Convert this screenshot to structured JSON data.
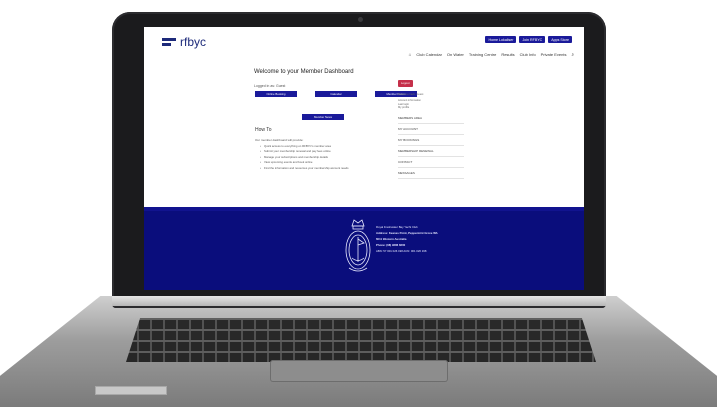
{
  "site": {
    "logo_text": "rfbyc",
    "top_buttons": [
      "Home Lokaliser",
      "Join RFBYC",
      "Apps Store"
    ],
    "nav": [
      "Club Calendar",
      "On Water",
      "Training Centre",
      "Results",
      "Club Info",
      "Private Events"
    ]
  },
  "main": {
    "welcome_title": "Welcome to your Member Dashboard",
    "logged_in": "Logged in as: Guest",
    "buttons": [
      "Online Booking",
      "Calendar",
      "Member Forum"
    ],
    "button_row2": "Member News",
    "how_title": "How To",
    "how_intro": "Our member dashboard will provide:",
    "how_items": [
      "Quick access to everything on RFBYC's member area",
      "Submit your membership renewal and pay fees online",
      "Manage your subscriptions and membership details",
      "View upcoming events and book online",
      "Find the information and resources your membership account needs"
    ]
  },
  "sidebar": {
    "logout_label": "Logout",
    "user_line": "Welcome back, Guest",
    "meta_lines": [
      "Account information",
      "Last login",
      "My profile"
    ],
    "menu": [
      "MEMBERS AREA",
      "MY ACCOUNT",
      "MY BOOKINGS",
      "MEMBERSHIP RENEWAL",
      "CONTACT",
      "MESSAGES"
    ]
  },
  "footer": {
    "lines": [
      "Royal Freshwater Bay Yacht Club",
      "Address: Keanes Point, Peppermint Grove WA",
      "6011 Western Australia",
      "Phone: (08) 9286 8200",
      "ABN: 57 001 026 198 ACN: 001 026 198"
    ]
  },
  "colors": {
    "brand_navy": "#0a0d7c",
    "button_blue": "#1a1a9a",
    "logout_red": "#c5304a",
    "laptop_bezel": "#1b1b1d"
  }
}
